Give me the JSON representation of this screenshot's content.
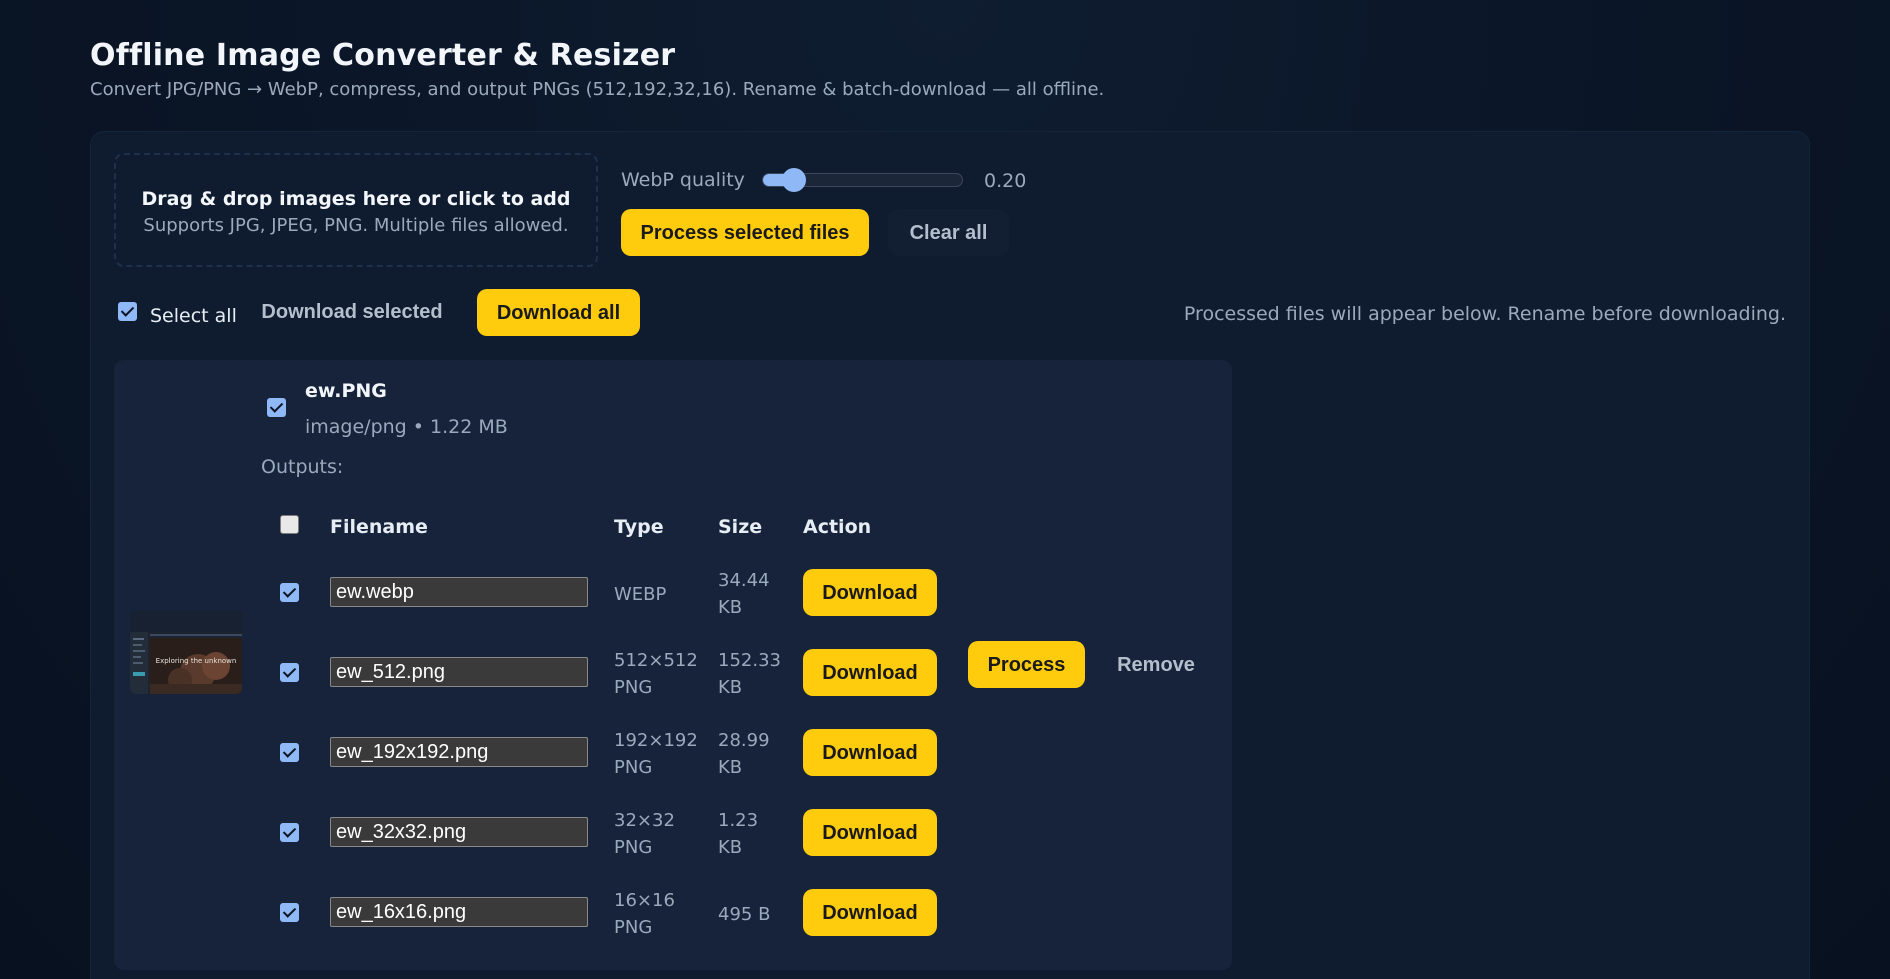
{
  "title": "Offline Image Converter & Resizer",
  "subtitle": "Convert JPG/PNG → WebP, compress, and output PNGs (512,192,32,16). Rename & batch-download — all offline.",
  "dropzone": {
    "title": "Drag & drop images here or click to add",
    "subtitle": "Supports JPG, JPEG, PNG. Multiple files allowed."
  },
  "quality": {
    "label": "WebP quality",
    "value_text": "0.20",
    "value": 0.2,
    "min": 0.1,
    "max": 1.0
  },
  "controls": {
    "process_selected": "Process selected files",
    "clear_all": "Clear all"
  },
  "toolbar": {
    "select_all_label": "Select all",
    "select_all_checked": true,
    "download_selected": "Download selected",
    "download_all": "Download all",
    "helper_text": "Processed files will appear below. Rename before downloading."
  },
  "file": {
    "name": "ew.PNG",
    "meta": "image/png • 1.22 MB",
    "checked": true,
    "outputs_label": "Outputs:",
    "process_label": "Process",
    "remove_label": "Remove",
    "thumbnail_overlay_text": "Exploring the unknown"
  },
  "table": {
    "headers": {
      "filename": "Filename",
      "type": "Type",
      "size": "Size",
      "action": "Action"
    },
    "header_checked": false,
    "rows": [
      {
        "checked": true,
        "filename": "ew.webp",
        "type_line1": "WEBP",
        "type_line2": "",
        "size_line1": "34.44",
        "size_line2": "KB",
        "action": "Download"
      },
      {
        "checked": true,
        "filename": "ew_512.png",
        "type_line1": "512×512",
        "type_line2": "PNG",
        "size_line1": "152.33",
        "size_line2": "KB",
        "action": "Download"
      },
      {
        "checked": true,
        "filename": "ew_192x192.png",
        "type_line1": "192×192",
        "type_line2": "PNG",
        "size_line1": "28.99",
        "size_line2": "KB",
        "action": "Download"
      },
      {
        "checked": true,
        "filename": "ew_32x32.png",
        "type_line1": "32×32",
        "type_line2": "PNG",
        "size_line1": "1.23",
        "size_line2": "KB",
        "action": "Download"
      },
      {
        "checked": true,
        "filename": "ew_16x16.png",
        "type_line1": "16×16",
        "type_line2": "PNG",
        "size_line1": "495 B",
        "size_line2": "",
        "action": "Download"
      }
    ]
  },
  "colors": {
    "background": "#0b1627",
    "panel": "#0f1c2f",
    "card": "#16233a",
    "accent": "#ffcc0d",
    "checkbox": "#8fb8f6",
    "muted_text": "#9aa9bb"
  }
}
